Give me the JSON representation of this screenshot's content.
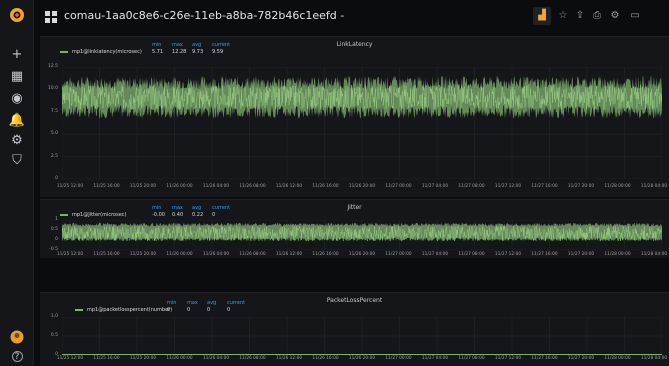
{
  "dashboard": {
    "title": "comau-1aa0c8e6-c26e-11eb-a8ba-782b46c1eefd -"
  },
  "colors": {
    "series": "#7eb26d",
    "legend_header": "#33a2e5",
    "brand": "#f1a32b",
    "panel_bg": "#141619"
  },
  "sidebar": {
    "items": [
      {
        "name": "create-icon",
        "glyph": "+"
      },
      {
        "name": "dashboards-icon",
        "glyph": "▦"
      },
      {
        "name": "explore-icon",
        "glyph": "◉"
      },
      {
        "name": "alerting-icon",
        "glyph": "🔔"
      },
      {
        "name": "configuration-icon",
        "glyph": "⚙"
      },
      {
        "name": "shield-icon",
        "glyph": "⛉"
      }
    ],
    "help_glyph": "?"
  },
  "toolbar": {
    "buttons": [
      {
        "name": "add-panel-icon",
        "glyph": "▟"
      },
      {
        "name": "star-icon",
        "glyph": "☆"
      },
      {
        "name": "share-icon",
        "glyph": "⇪"
      },
      {
        "name": "save-icon",
        "glyph": "⎙"
      },
      {
        "name": "settings-icon",
        "glyph": "⚙"
      },
      {
        "name": "tv-mode-icon",
        "glyph": "▭"
      }
    ]
  },
  "legend_headers": {
    "min": "min",
    "max": "max",
    "avg": "avg",
    "current": "current"
  },
  "panels": [
    {
      "title": "LinkLatency",
      "legend": {
        "series": "mp1@linklatency(microsec)",
        "min": "5.71",
        "max": "12.28",
        "avg": "9.73",
        "current": "9.59"
      },
      "yticks": [
        "12.5",
        "10.0",
        "7.5",
        "5.0",
        "2.5",
        "0"
      ],
      "xticks": [
        "11/25 12:00",
        "11/25 16:00",
        "11/25 20:00",
        "11/26 00:00",
        "11/26 04:00",
        "11/26 08:00",
        "11/26 12:00",
        "11/26 16:00",
        "11/26 20:00",
        "11/27 00:00",
        "11/27 04:00",
        "11/27 08:00",
        "11/27 12:00",
        "11/27 16:00",
        "11/27 20:00",
        "11/28 00:00",
        "11/28 04:00"
      ]
    },
    {
      "title": "Jitter",
      "legend": {
        "series": "mp1@Jitter(microsec)",
        "min": "-0.00",
        "max": "0.40",
        "avg": "0.22",
        "current": "0"
      },
      "yticks": [
        "1",
        "0.5",
        "0",
        "-0.5"
      ],
      "xticks": [
        "11/25 12:00",
        "11/25 16:00",
        "11/25 20:00",
        "11/26 00:00",
        "11/26 04:00",
        "11/26 08:00",
        "11/26 12:00",
        "11/26 16:00",
        "11/26 20:00",
        "11/27 00:00",
        "11/27 04:00",
        "11/27 08:00",
        "11/27 12:00",
        "11/27 16:00",
        "11/27 20:00",
        "11/28 00:00",
        "11/28 04:00"
      ]
    },
    {
      "title": "PacketLossPercent",
      "legend": {
        "series": "mp1@packetlosspercent(number)",
        "min": "0",
        "max": "0",
        "avg": "0",
        "current": "0"
      },
      "yticks": [
        "1.0",
        "0.5",
        "0"
      ],
      "xticks": [
        "11/25 12:00",
        "11/25 16:00",
        "11/25 20:00",
        "11/26 00:00",
        "11/26 04:00",
        "11/26 08:00",
        "11/26 12:00",
        "11/26 16:00",
        "11/26 20:00",
        "11/27 00:00",
        "11/27 04:00",
        "11/27 08:00",
        "11/27 12:00",
        "11/27 16:00",
        "11/27 20:00",
        "11/28 00:00",
        "11/28 04:00"
      ]
    }
  ],
  "chart_data": [
    {
      "type": "area",
      "title": "LinkLatency",
      "series": [
        {
          "name": "mp1@linklatency(microsec)",
          "min": 5.71,
          "max": 12.28,
          "avg": 9.73,
          "current": 9.59
        }
      ],
      "ylim": [
        0,
        12.5
      ]
    },
    {
      "type": "area",
      "title": "Jitter",
      "series": [
        {
          "name": "mp1@Jitter(microsec)",
          "min": 0,
          "max": 0.4,
          "avg": 0.22,
          "current": 0
        }
      ],
      "ylim": [
        -0.5,
        1
      ]
    },
    {
      "type": "line",
      "title": "PacketLossPercent",
      "series": [
        {
          "name": "mp1@packetlosspercent(number)",
          "min": 0,
          "max": 0,
          "avg": 0,
          "current": 0
        }
      ],
      "ylim": [
        0,
        1
      ]
    }
  ]
}
